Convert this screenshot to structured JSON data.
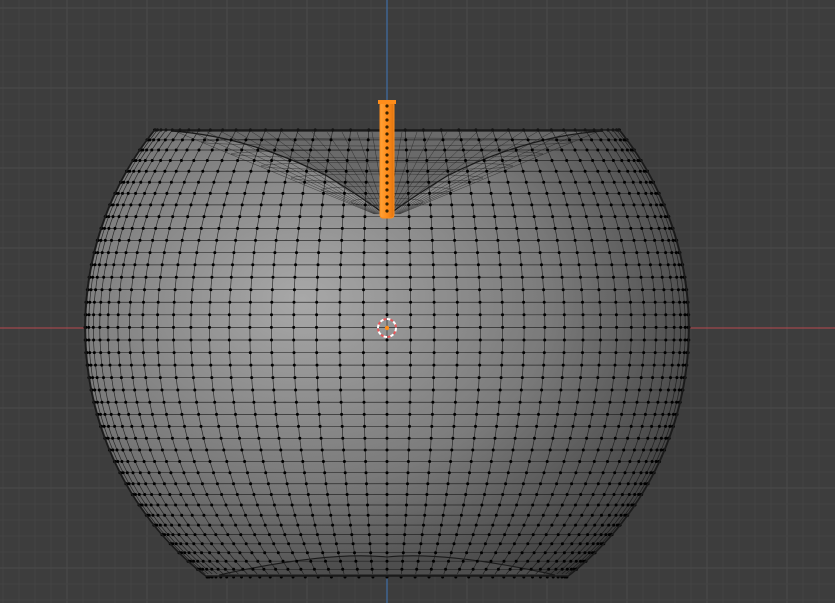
{
  "viewport": {
    "view": "front-orthographic",
    "mode": "edit-mode",
    "selection_mode": "vertex",
    "shading": "solid-with-wireframe-overlay"
  },
  "colors": {
    "background": "#3d3d3d",
    "grid_minor": "#434343",
    "grid_major": "#4a4a4a",
    "axis_x": "#a0474d",
    "axis_z": "#3f6ea6",
    "mesh_shade_light": "#a8a8a8",
    "mesh_shade_mid": "#7a7a7a",
    "mesh_shade_dark": "#3a3a3a",
    "wire": "#1a1a1a",
    "vertex": "#000000",
    "selected": "#ff8d1a",
    "cursor_red": "#e8575a",
    "cursor_white": "#ffffff"
  },
  "mesh": {
    "name": "apple",
    "edge_loops": 40,
    "meridians": 40,
    "stem_selected": true
  },
  "icons": {
    "cursor": "3d-cursor-icon",
    "origin": "object-origin-icon"
  }
}
